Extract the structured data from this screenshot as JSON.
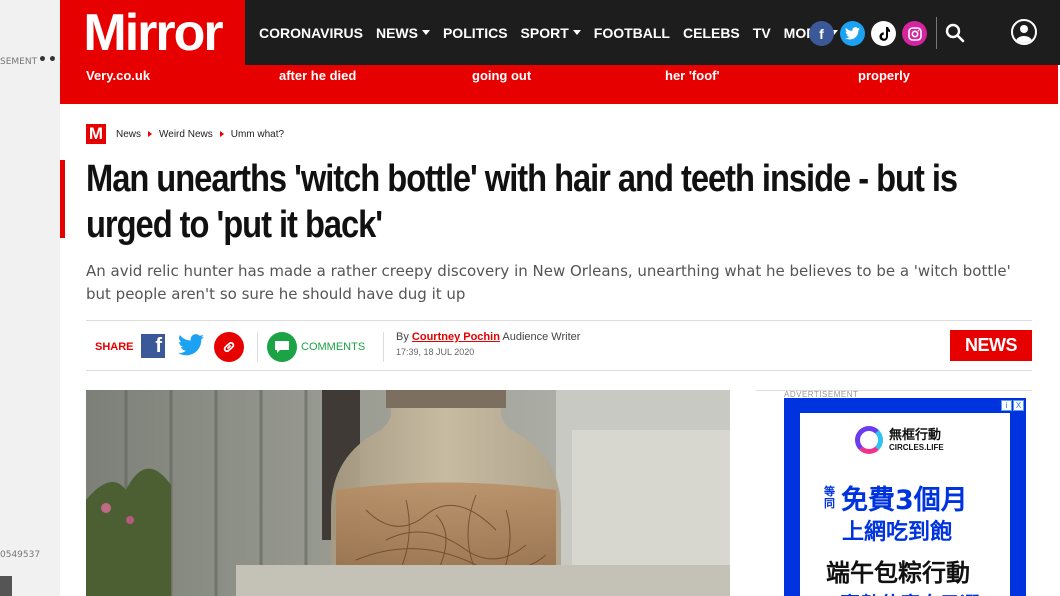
{
  "gutter": {
    "ad_label": "SEMENT",
    "dots": "•••",
    "number": "0549537"
  },
  "header": {
    "logo": "Mirror",
    "nav": [
      {
        "label": "CORONAVIRUS",
        "dropdown": false
      },
      {
        "label": "NEWS",
        "dropdown": true
      },
      {
        "label": "POLITICS",
        "dropdown": false
      },
      {
        "label": "SPORT",
        "dropdown": true
      },
      {
        "label": "FOOTBALL",
        "dropdown": false
      },
      {
        "label": "CELEBS",
        "dropdown": false
      },
      {
        "label": "TV",
        "dropdown": false
      },
      {
        "label": "MORE",
        "dropdown": true
      }
    ],
    "social": {
      "facebook": "f",
      "twitter": "twitter-icon",
      "tiktok": "tiktok-icon",
      "instagram": "instagram-icon"
    }
  },
  "promo_strip": [
    "Very.co.uk",
    "after he died",
    "going out",
    "her 'foof'",
    "properly"
  ],
  "breadcrumb": {
    "logo": "M",
    "items": [
      "News",
      "Weird News",
      "Umm what?"
    ]
  },
  "article": {
    "headline": "Man unearths 'witch bottle' with hair and teeth inside - but is urged to 'put it back'",
    "standfirst": "An avid relic hunter has made a rather creepy discovery in New Orleans, unearthing what he believes to be a 'witch bottle' but people aren't so sure he should have dug it up",
    "share_label": "SHARE",
    "comments_label": "COMMENTS",
    "by_prefix": "By",
    "author": "Courtney Pochin",
    "author_role": "Audience Writer",
    "timestamp": "17:39, 18 JUL 2020",
    "section_badge": "NEWS"
  },
  "ad": {
    "label": "ADVERTISEMENT",
    "brand_cn": "無框行動",
    "brand_en": "CIRCLES.LIFE",
    "small": "等同",
    "line1": "免費3個月",
    "line2": "上網吃到飽",
    "line3": "端午包粽行動",
    "line4": "贏數什麼自己選",
    "close": "X"
  },
  "colors": {
    "brand_red": "#e60000",
    "nav_dark": "#1d1d1d",
    "ad_blue": "#0033e0",
    "comments_green": "#1ba345"
  }
}
